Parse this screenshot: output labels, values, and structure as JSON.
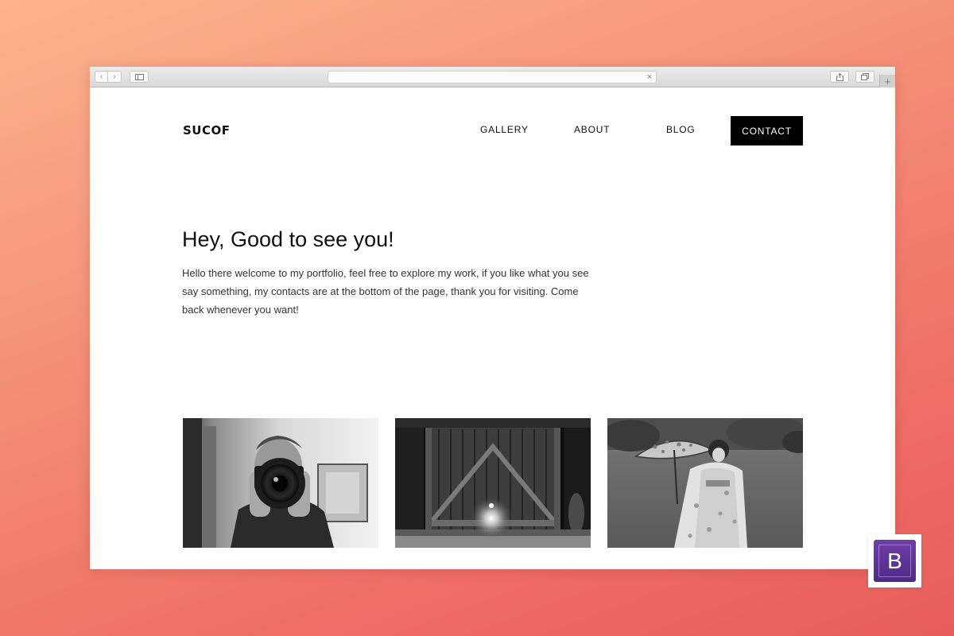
{
  "browser": {
    "back_icon": "chevron-left-icon",
    "forward_icon": "chevron-right-icon",
    "sidebar_icon": "sidebar-icon",
    "address_value": "",
    "share_icon": "share-icon",
    "tabs_icon": "tabs-icon",
    "new_tab_icon": "plus-icon"
  },
  "site": {
    "logo": "SUCOF",
    "nav": {
      "gallery": "GALLERY",
      "about": "ABOUT",
      "blog": "BLOG",
      "contact": "CONTACT"
    },
    "heading": "Hey, Good to see you!",
    "intro": "Hello there welcome to my portfolio, feel free to explore my work, if you like what you see say something, my contacts are at the bottom of the page, thank you for visiting. Come back whenever you want!"
  },
  "gallery": {
    "images": [
      {
        "subject": "photographer-with-camera"
      },
      {
        "subject": "wooden-barn-door"
      },
      {
        "subject": "woman-in-kimono-with-parasol"
      }
    ]
  },
  "badge": {
    "letter": "B",
    "color": "#563d7c"
  },
  "colors": {
    "background_start": "#fcb48e",
    "background_end": "#e85c5c",
    "contact_button": "#000000"
  }
}
